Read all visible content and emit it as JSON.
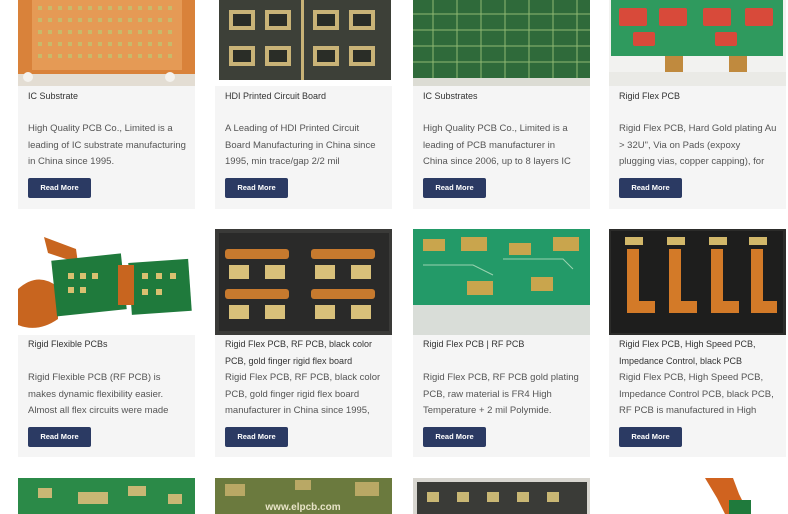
{
  "products": [
    {
      "title": "IC Substrate",
      "description": "High Quality PCB Co., Limited is a leading of IC substrate manufacturing in China since 1995.",
      "button": "Read More",
      "image_icon": "ic-substrate-image"
    },
    {
      "title": "HDI Printed Circuit Board",
      "description": "A Leading of HDI Printed Circuit Board Manufacturing in China since 1995, min trace/gap 2/2 mil",
      "button": "Read More",
      "image_icon": "hdi-board-image"
    },
    {
      "title": "IC Substrates",
      "description": "High Quality PCB Co., Limited is a leading of PCB manufacturer in China since 2006, up to 8 layers IC",
      "button": "Read More",
      "image_icon": "ic-substrates-image"
    },
    {
      "title": "Rigid Flex PCB",
      "description": "Rigid Flex PCB, Hard Gold plating Au > 32U\", Via on Pads (expoxy plugging vias, copper capping), for",
      "button": "Read More",
      "image_icon": "rigid-flex-image"
    },
    {
      "title": "Rigid Flexible PCBs",
      "description": "Rigid Flexible PCB (RF PCB) is makes dynamic flexibility easier. Almost all flex circuits were made",
      "button": "Read More",
      "image_icon": "rigid-flexible-image"
    },
    {
      "title": "Rigid Flex PCB, RF PCB, black color PCB, gold finger rigid flex board",
      "description": "Rigid Flex PCB, RF PCB, black color PCB, gold finger rigid flex board manufacturer in China since 1995,",
      "button": "Read More",
      "image_icon": "black-rigid-flex-image"
    },
    {
      "title": "Rigid Flex PCB | RF PCB",
      "description": "Rigid Flex PCB, RF PCB gold plating PCB, raw material is FR4 High Temperature + 2 mil Polymide.",
      "button": "Read More",
      "image_icon": "rf-pcb-image"
    },
    {
      "title": "Rigid Flex PCB, High Speed PCB, Impedance Control, black PCB",
      "description": "Rigid Flex PCB, High Speed PCB, Impedance Control PCB, black PCB, RF PCB is manufactured in High",
      "button": "Read More",
      "image_icon": "high-speed-image"
    },
    {
      "title": "",
      "description": "",
      "button": "",
      "image_icon": "pcb-green-image"
    },
    {
      "title": "",
      "description": "",
      "button": "",
      "image_icon": "pcb-olive-image",
      "watermark": "www.elpcb.com"
    },
    {
      "title": "",
      "description": "",
      "button": "",
      "image_icon": "pcb-dark-image"
    },
    {
      "title": "",
      "description": "",
      "button": "",
      "image_icon": "flex-cable-image"
    }
  ],
  "colors": {
    "button_bg": "#2b3a63",
    "card_bg": "#f5f5f5",
    "title_text": "#333333",
    "desc_text": "#555555"
  }
}
